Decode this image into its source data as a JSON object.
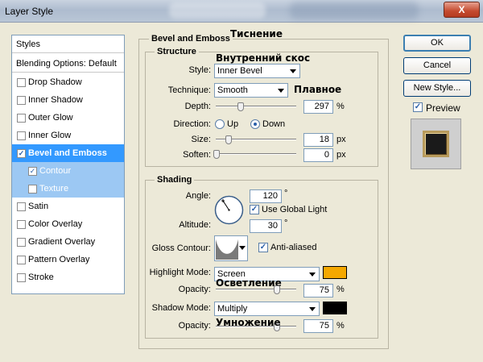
{
  "window": {
    "title": "Layer Style",
    "close_label": "X"
  },
  "sidebar": {
    "header": "Styles",
    "blending": "Blending Options: Default",
    "items": [
      {
        "label": "Drop Shadow",
        "checked": false
      },
      {
        "label": "Inner Shadow",
        "checked": false
      },
      {
        "label": "Outer Glow",
        "checked": false
      },
      {
        "label": "Inner Glow",
        "checked": false
      },
      {
        "label": "Bevel and Emboss",
        "checked": true
      },
      {
        "label": "Contour",
        "checked": true
      },
      {
        "label": "Texture",
        "checked": false
      },
      {
        "label": "Satin",
        "checked": false
      },
      {
        "label": "Color Overlay",
        "checked": false
      },
      {
        "label": "Gradient Overlay",
        "checked": false
      },
      {
        "label": "Pattern Overlay",
        "checked": false
      },
      {
        "label": "Stroke",
        "checked": false
      }
    ],
    "check_mark": "✓"
  },
  "bevel": {
    "title": "Bevel and Emboss",
    "title_ru": "Тиснение",
    "structure": {
      "title": "Structure",
      "style_label": "Style:",
      "style_value": "Inner Bevel",
      "style_ru": "Внутренний скос",
      "technique_label": "Technique:",
      "technique_value": "Smooth",
      "technique_ru": "Плавное",
      "depth_label": "Depth:",
      "depth_value": "297",
      "depth_unit": "%",
      "direction_label": "Direction:",
      "direction_up": "Up",
      "direction_down": "Down",
      "size_label": "Size:",
      "size_value": "18",
      "size_unit": "px",
      "soften_label": "Soften:",
      "soften_value": "0",
      "soften_unit": "px"
    },
    "shading": {
      "title": "Shading",
      "angle_label": "Angle:",
      "angle_value": "120",
      "angle_unit": "°",
      "global_light_label": "Use Global Light",
      "altitude_label": "Altitude:",
      "altitude_value": "30",
      "altitude_unit": "°",
      "gloss_label": "Gloss Contour:",
      "anti_aliased_label": "Anti-aliased",
      "highlight_mode_label": "Highlight Mode:",
      "highlight_mode_value": "Screen",
      "highlight_color": "#f5a800",
      "highlight_opacity_label": "Opacity:",
      "highlight_opacity_value": "75",
      "highlight_opacity_unit": "%",
      "highlight_ru": "Осветление",
      "shadow_mode_label": "Shadow Mode:",
      "shadow_mode_value": "Multiply",
      "shadow_color": "#000000",
      "shadow_opacity_label": "Opacity:",
      "shadow_opacity_value": "75",
      "shadow_opacity_unit": "%",
      "shadow_ru": "Умножение"
    }
  },
  "buttons": {
    "ok": "OK",
    "cancel": "Cancel",
    "new_style": "New Style...",
    "preview": "Preview"
  }
}
